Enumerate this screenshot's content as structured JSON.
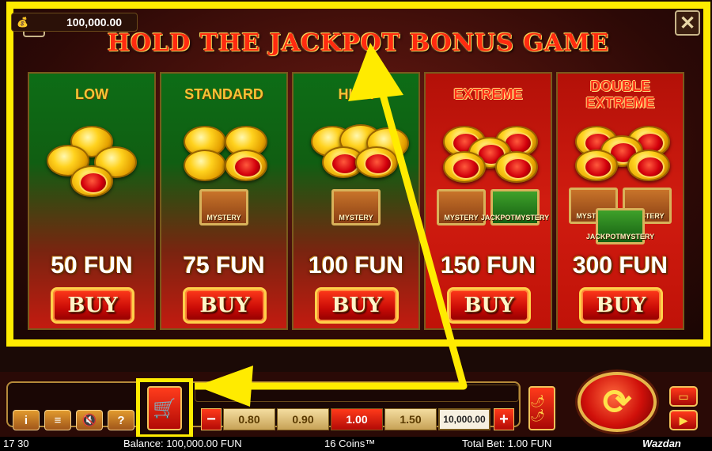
{
  "title": "HOLD THE JACKPOT BONUS GAME",
  "close_icon": "close-icon",
  "menu_icon": "menu-icon",
  "tiers": [
    {
      "name": "LOW",
      "price": "50 FUN",
      "buy": "BUY"
    },
    {
      "name": "STANDARD",
      "price": "75 FUN",
      "buy": "BUY"
    },
    {
      "name": "HIGH",
      "price": "100 FUN",
      "buy": "BUY"
    },
    {
      "name": "EXTREME",
      "price": "150 FUN",
      "buy": "BUY"
    },
    {
      "name_line1": "DOUBLE",
      "name_line2": "EXTREME",
      "price": "300 FUN",
      "buy": "BUY"
    }
  ],
  "chest_labels": {
    "mystery": "MYSTERY",
    "jackpot_mystery_1": "JACKPOT",
    "jackpot_mystery_2": "MYSTERY"
  },
  "balance": "100,000.00",
  "bet_options": [
    "0.80",
    "0.90",
    "1.00",
    "1.50"
  ],
  "selected_bet": "1.00",
  "total_chip": "10,000.00",
  "control_labels": {
    "info": "i",
    "menu": "≡",
    "sound": "🔇",
    "help": "?",
    "minus": "−",
    "plus": "+"
  },
  "status": {
    "time": "17 30",
    "balance": "Balance: 100,000.00 FUN",
    "coins": "16 Coins™",
    "total_bet": "Total Bet: 1.00 FUN",
    "brand": "Wazdan"
  },
  "colors": {
    "highlight": "#ffeb00",
    "title_red": "#ff2a10",
    "gold": "#ffd21e"
  }
}
